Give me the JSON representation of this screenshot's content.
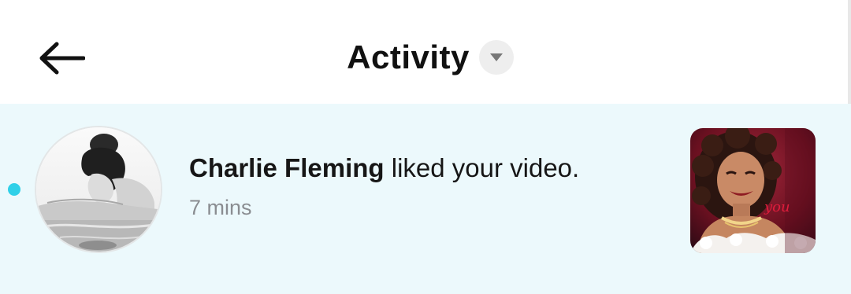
{
  "header": {
    "back_icon": "arrow-left-icon",
    "title": "Activity",
    "dropdown_icon": "caret-down-icon"
  },
  "notifications": [
    {
      "username": "Charlie Fleming",
      "action": "liked your video.",
      "time": "7 mins",
      "unread": true,
      "thumbnail_caption": "you"
    }
  ],
  "colors": {
    "row_background": "#ecf9fc",
    "unread_dot": "#2fd0e8",
    "text_primary": "#161616",
    "text_secondary": "#8a8d91"
  }
}
